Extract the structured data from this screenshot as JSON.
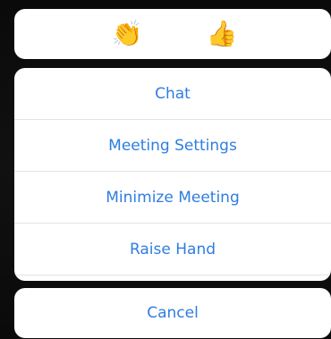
{
  "reactions": {
    "clap": {
      "glyph": "👏",
      "icon": "clapping-hands-icon"
    },
    "thumbs_up": {
      "glyph": "👍",
      "icon": "thumbs-up-icon"
    }
  },
  "menu": {
    "items": [
      {
        "label": "Chat"
      },
      {
        "label": "Meeting Settings"
      },
      {
        "label": "Minimize Meeting"
      },
      {
        "label": "Raise Hand"
      }
    ]
  },
  "cancel": {
    "label": "Cancel"
  },
  "colors": {
    "accent": "#2f7de0",
    "sheet_background": "#ffffff",
    "backdrop": "#000000",
    "separator": "#e3e3e6"
  }
}
